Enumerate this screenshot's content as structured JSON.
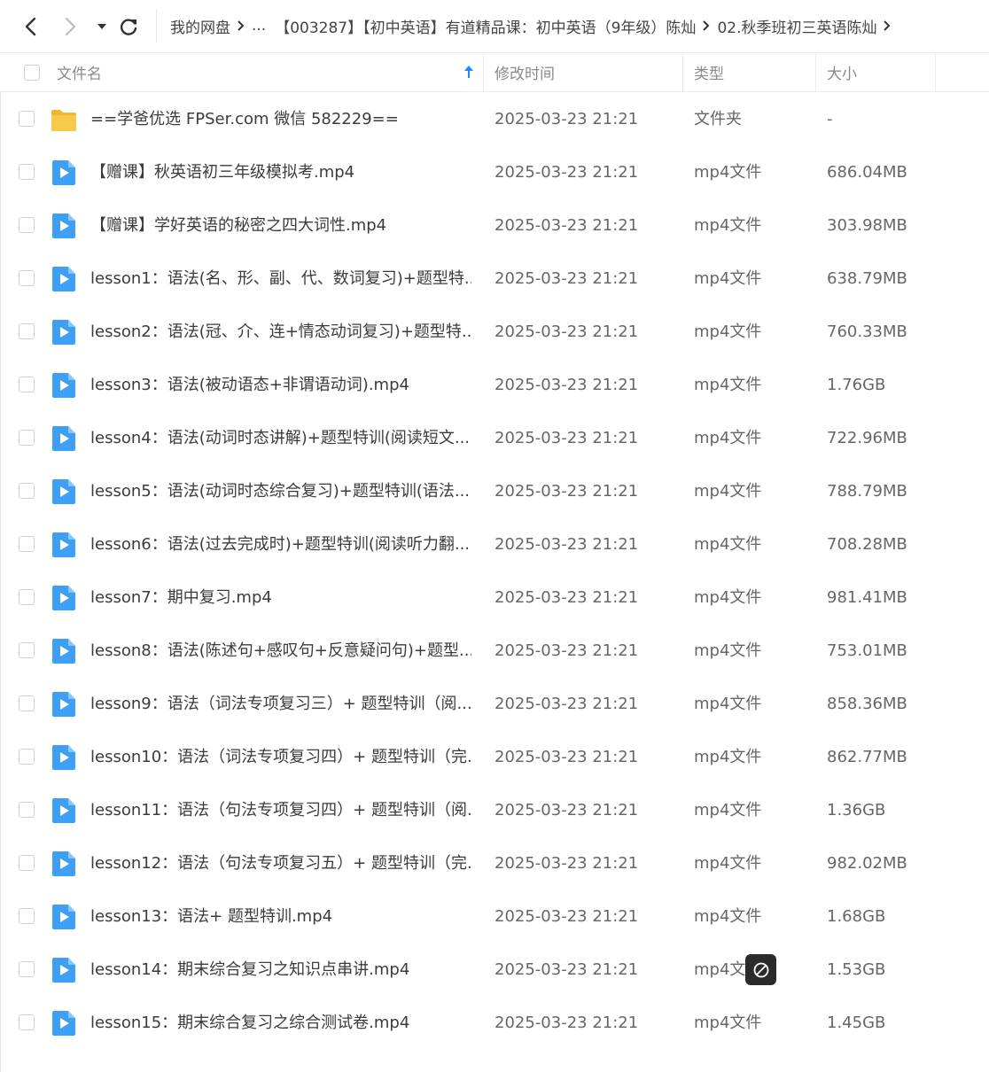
{
  "breadcrumb": {
    "items": [
      "我的网盘",
      "...",
      "【003287】【初中英语】有道精品课：初中英语（9年级）陈灿",
      "02.秋季班初三英语陈灿"
    ]
  },
  "columns": {
    "name": "文件名",
    "modified": "修改时间",
    "type": "类型",
    "size": "大小"
  },
  "icons": {
    "back": "chevron-left-icon",
    "forward": "chevron-right-icon",
    "dropdown": "caret-down-icon",
    "refresh": "refresh-icon",
    "sort": "sort-up-arrow-icon",
    "folder": "folder-icon",
    "video": "video-file-icon",
    "disabled": "disabled-cursor-icon"
  },
  "colors": {
    "accent": "#1a8cff",
    "folder": "#f7c948",
    "video": "#3d9ff5"
  },
  "files": [
    {
      "name": "==学爸优选 FPSer.com 微信 582229==",
      "modified": "2025-03-23 21:21",
      "type": "文件夹",
      "size": "-",
      "kind": "folder"
    },
    {
      "name": "【赠课】秋英语初三年级模拟考.mp4",
      "modified": "2025-03-23 21:21",
      "type": "mp4文件",
      "size": "686.04MB",
      "kind": "video"
    },
    {
      "name": "【赠课】学好英语的秘密之四大词性.mp4",
      "modified": "2025-03-23 21:21",
      "type": "mp4文件",
      "size": "303.98MB",
      "kind": "video"
    },
    {
      "name": "lesson1：语法(名、形、副、代、数词复习)+题型特...",
      "modified": "2025-03-23 21:21",
      "type": "mp4文件",
      "size": "638.79MB",
      "kind": "video"
    },
    {
      "name": "lesson2：语法(冠、介、连+情态动词复习)+题型特...",
      "modified": "2025-03-23 21:21",
      "type": "mp4文件",
      "size": "760.33MB",
      "kind": "video"
    },
    {
      "name": "lesson3：语法(被动语态+非谓语动词).mp4",
      "modified": "2025-03-23 21:21",
      "type": "mp4文件",
      "size": "1.76GB",
      "kind": "video"
    },
    {
      "name": "lesson4：语法(动词时态讲解)+题型特训(阅读短文...",
      "modified": "2025-03-23 21:21",
      "type": "mp4文件",
      "size": "722.96MB",
      "kind": "video"
    },
    {
      "name": "lesson5：语法(动词时态综合复习)+题型特训(语法...",
      "modified": "2025-03-23 21:21",
      "type": "mp4文件",
      "size": "788.79MB",
      "kind": "video"
    },
    {
      "name": "lesson6：语法(过去完成时)+题型特训(阅读听力翻...",
      "modified": "2025-03-23 21:21",
      "type": "mp4文件",
      "size": "708.28MB",
      "kind": "video"
    },
    {
      "name": "lesson7：期中复习.mp4",
      "modified": "2025-03-23 21:21",
      "type": "mp4文件",
      "size": "981.41MB",
      "kind": "video"
    },
    {
      "name": "lesson8：语法(陈述句+感叹句+反意疑问句)+题型...",
      "modified": "2025-03-23 21:21",
      "type": "mp4文件",
      "size": "753.01MB",
      "kind": "video"
    },
    {
      "name": "lesson9：语法（词法专项复习三）+ 题型特训（阅...",
      "modified": "2025-03-23 21:21",
      "type": "mp4文件",
      "size": "858.36MB",
      "kind": "video"
    },
    {
      "name": "lesson10：语法（词法专项复习四）+ 题型特训（完...",
      "modified": "2025-03-23 21:21",
      "type": "mp4文件",
      "size": "862.77MB",
      "kind": "video"
    },
    {
      "name": "lesson11：语法（句法专项复习四）+ 题型特训（阅...",
      "modified": "2025-03-23 21:21",
      "type": "mp4文件",
      "size": "1.36GB",
      "kind": "video"
    },
    {
      "name": "lesson12：语法（句法专项复习五）+ 题型特训（完...",
      "modified": "2025-03-23 21:21",
      "type": "mp4文件",
      "size": "982.02MB",
      "kind": "video"
    },
    {
      "name": "lesson13：语法+ 题型特训.mp4",
      "modified": "2025-03-23 21:21",
      "type": "mp4文件",
      "size": "1.68GB",
      "kind": "video"
    },
    {
      "name": "lesson14：期末综合复习之知识点串讲.mp4",
      "modified": "2025-03-23 21:21",
      "type": "mp4文",
      "size": "1.53GB",
      "kind": "video"
    },
    {
      "name": "lesson15：期末综合复习之综合测试卷.mp4",
      "modified": "2025-03-23 21:21",
      "type": "mp4文件",
      "size": "1.45GB",
      "kind": "video"
    }
  ]
}
